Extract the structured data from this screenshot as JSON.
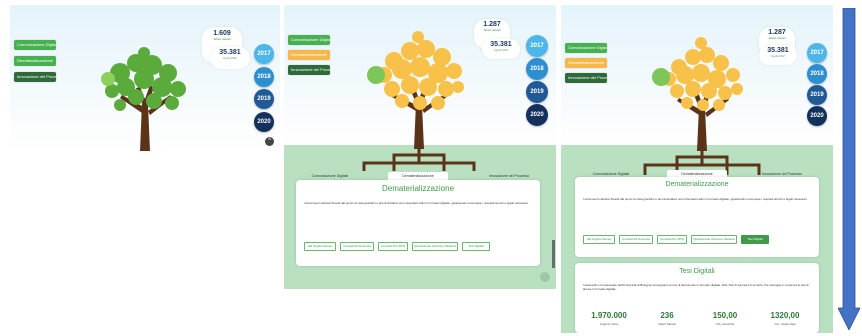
{
  "sidebar": {
    "items": [
      {
        "label": "Comunicazione Digitale"
      },
      {
        "label": "Dematerializzazione"
      },
      {
        "label": "Innovazione del Processo"
      }
    ]
  },
  "years": [
    "2017",
    "2018",
    "2019",
    "2020"
  ],
  "panel1": {
    "stats": {
      "count": "1.609",
      "count_label": "Alberi salvati",
      "co2": "35.381",
      "co2_label": "kg di CO2"
    }
  },
  "panel2": {
    "stats": {
      "count": "1.287",
      "count_label": "Alberi salvati",
      "co2": "35.381",
      "co2_label": "kg di CO2"
    },
    "tabs": [
      "Comunicazione Digitale",
      "Dematerializzazione",
      "Innovazione del Processo"
    ],
    "card_title": "Dematerializzazione",
    "card_text": "I documenti cartacei filosofi dal punto di vista giuridico e amministrativo sono diventati nativi in formato digitale, garantendo comunque i requisiti tecnici e legali necessari.",
    "chips": [
      "Atti Organi Ateneo",
      "Contratti Di Docenza",
      "Contratti Per RTD",
      "Questionario Opinione Studenti",
      "Tesi Digitali"
    ]
  },
  "panel3": {
    "stats": {
      "count": "1.287",
      "count_label": "Alberi salvati",
      "co2": "35.381",
      "co2_label": "kg di CO2"
    },
    "tabs": [
      "Comunicazione Digitale",
      "Dematerializzazione",
      "Innovazione del Processo"
    ],
    "card_title": "Dematerializzazione",
    "card_text": "I documenti cartacei filosofi dal punto di vista giuridico e amministrativo sono diventati nativi in formato digitale, garantendo comunque i requisiti tecnici e legali necessari.",
    "chips": [
      "Atti Organi Ateneo",
      "Contratti Di Docenza",
      "Contratti Per RTD",
      "Questionario Opinione Studenti",
      "Tesi Digitali"
    ],
    "tesi": {
      "title": "Tesi Digitali",
      "text": "I laureandi e le laureande dell'Università di Bologna consegnano le tesi di laurea solo in formato digitale. DAL Tesi di Laurea è il servizio che raccoglie e conserva le tesi di laurea in formato digitale.",
      "stats": [
        {
          "value": "1.970.000",
          "label": "Fogli di Carta"
        },
        {
          "value": "236",
          "label": "Alberi Salvati"
        },
        {
          "value": "150,00",
          "label": "CO₂ assorbita"
        },
        {
          "value": "1320,00",
          "label": "CO₂ risparmiata"
        }
      ]
    }
  },
  "colors": {
    "green_side": "#48b14f",
    "orange_side": "#f7b84a",
    "year2017": "#4db6e8",
    "year2018": "#2d8fd0",
    "year2019": "#1f5a96",
    "year2020": "#13315c",
    "leaf_green": "#5bab3c",
    "leaf_orange": "#f8c24a",
    "trunk": "#5b3318",
    "scroll_arrow": "#4472c4"
  }
}
